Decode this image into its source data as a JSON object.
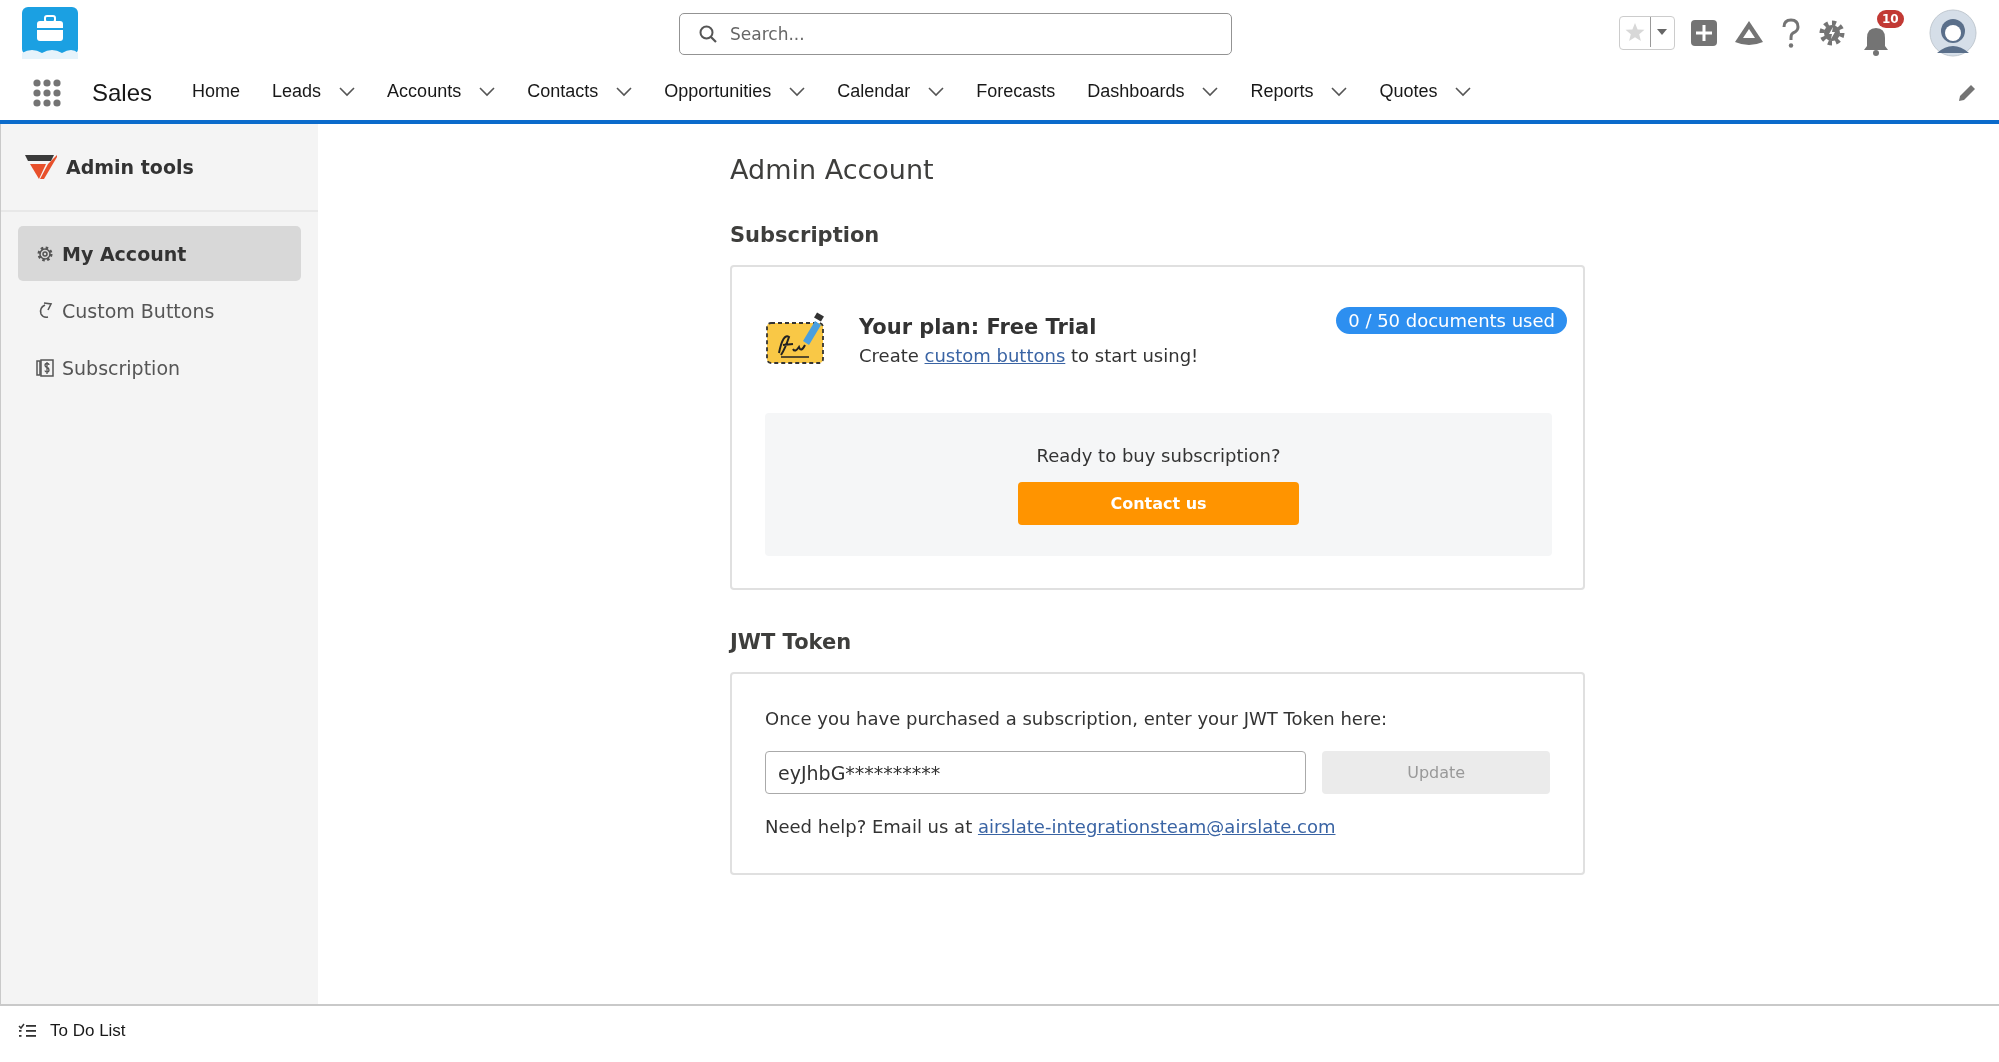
{
  "app": {
    "name": "Sales"
  },
  "search": {
    "placeholder": "Search..."
  },
  "notifications": {
    "count": "10"
  },
  "nav": [
    {
      "label": "Home",
      "dropdown": false,
      "selected": false
    },
    {
      "label": "Leads",
      "dropdown": true,
      "selected": false
    },
    {
      "label": "Accounts",
      "dropdown": true,
      "selected": false
    },
    {
      "label": "Contacts",
      "dropdown": true,
      "selected": false
    },
    {
      "label": "Opportunities",
      "dropdown": true,
      "selected": false
    },
    {
      "label": "Calendar",
      "dropdown": true,
      "selected": false
    },
    {
      "label": "Forecasts",
      "dropdown": false,
      "selected": false
    },
    {
      "label": "Dashboards",
      "dropdown": true,
      "selected": false
    },
    {
      "label": "Reports",
      "dropdown": true,
      "selected": false
    },
    {
      "label": "Quotes",
      "dropdown": true,
      "selected": false
    }
  ],
  "sidebar": {
    "title": "Admin tools",
    "items": [
      {
        "label": "My Account",
        "kind": "gear",
        "selected": true
      },
      {
        "label": "Custom Buttons",
        "kind": "button",
        "selected": false
      },
      {
        "label": "Subscription",
        "kind": "dollar",
        "selected": false
      }
    ]
  },
  "page": {
    "title": "Admin Account"
  },
  "subscription": {
    "heading": "Subscription",
    "plan": "Your plan: Free Trial",
    "description_before": "Create ",
    "description_link": "custom buttons",
    "description_after": " to start using!",
    "usage": "0 / 50 documents used",
    "prompt": "Ready to buy subscription?",
    "button": "Contact us"
  },
  "jwt": {
    "heading": "JWT Token",
    "instructions": "Once you have purchased a subscription, enter your JWT Token here:",
    "value": "eyJhbG**********",
    "button": {
      "label": "Update",
      "disabled": true
    },
    "help": "Need help? Email us at ",
    "email": "airslate-integrationsteam@airslate.com"
  },
  "footer": {
    "label": "To Do List"
  }
}
